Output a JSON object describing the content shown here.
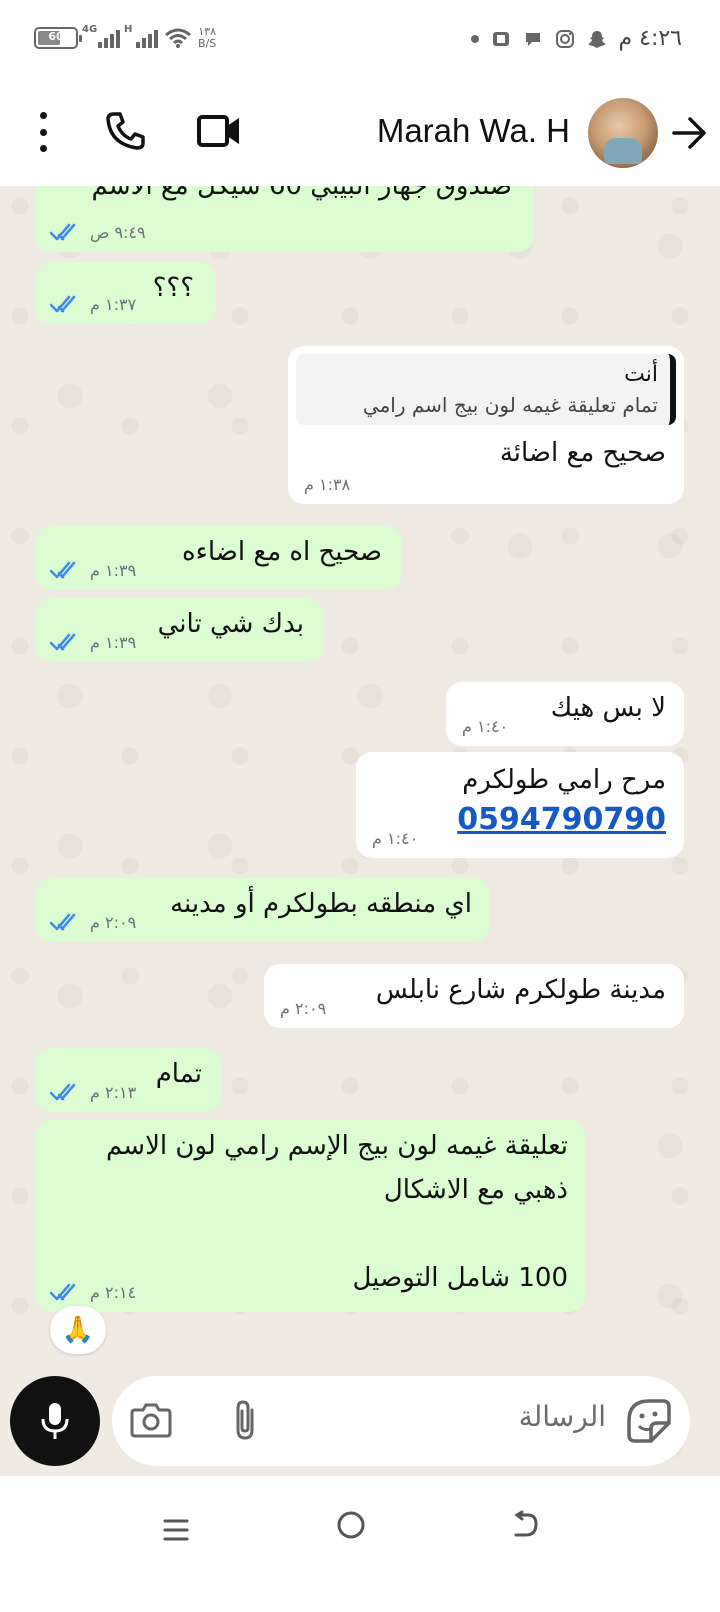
{
  "status_bar": {
    "time": "٤:٢٦ م",
    "battery": "60",
    "battery_level": 0.6,
    "network_1": "4G",
    "network_2": "H",
    "speed_value": "١٣٨",
    "speed_unit": "B/S"
  },
  "header": {
    "contact_name": "Marah Wa. H"
  },
  "messages": [
    {
      "id": "m0",
      "type": "in",
      "text": "صندوق جهاز البيبي 60 شيكل مع الاسم",
      "time": "٩:٤٩ ص"
    },
    {
      "id": "m1",
      "type": "in",
      "text": "؟؟؟",
      "time": "١:٣٧ م"
    },
    {
      "id": "m2",
      "type": "out",
      "quote_author": "أنت",
      "quote_text": "تمام تعليقة غيمه لون بيج اسم رامي",
      "text": "صحيح مع اضائة",
      "time": "١:٣٨ م"
    },
    {
      "id": "m3",
      "type": "in",
      "text": "صحيح اه مع اضاءه",
      "time": "١:٣٩ م"
    },
    {
      "id": "m4",
      "type": "in",
      "text": "بدك شي تاني",
      "time": "١:٣٩ م"
    },
    {
      "id": "m5",
      "type": "out",
      "text": "لا بس هيك",
      "time": "١:٤٠ م"
    },
    {
      "id": "m6",
      "type": "out",
      "text": "مرح رامي طولكرم",
      "link": "0594790790",
      "time": "١:٤٠ م"
    },
    {
      "id": "m7",
      "type": "in",
      "text": "اي منطقه بطولكرم أو مدينه",
      "time": "٢:٠٩ م"
    },
    {
      "id": "m8",
      "type": "out",
      "text": "مدينة طولكرم شارع نابلس",
      "time": "٢:٠٩ م"
    },
    {
      "id": "m9",
      "type": "in",
      "text": "تمام",
      "time": "٢:١٣ م"
    },
    {
      "id": "m10",
      "type": "in",
      "text": "تعليقة غيمه لون بيج الإسم رامي لون الاسم\nذهبي مع الاشكال\n\n100 شامل التوصيل",
      "time": "٢:١٤ م"
    }
  ],
  "reaction": "🙏",
  "composer": {
    "placeholder": "الرسالة"
  },
  "colors": {
    "incoming_bubble": "#dcfcd2",
    "outgoing_bubble": "#ffffff",
    "read_ticks": "#3d8bf0",
    "link": "#1559c7",
    "chat_background": "#efeae2"
  }
}
